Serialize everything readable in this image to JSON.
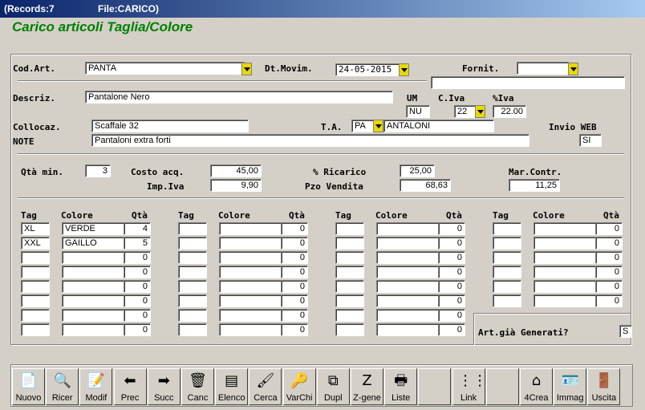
{
  "window": {
    "records": "(Records:7",
    "file": "File:CARICO)"
  },
  "form_title": "Carico articoli Taglia/Colore",
  "labels": {
    "cod_art": "Cod.Art.",
    "dt_movim": "Dt.Movim.",
    "fornit": "Fornit.",
    "descriz": "Descriz.",
    "um": "UM",
    "c_iva": "C.Iva",
    "perc_iva": "%Iva",
    "collocaz": "Collocaz.",
    "ta": "T.A.",
    "invio_web": "Invio WEB",
    "note": "NOTE",
    "qta_min": "Qtà min.",
    "costo_acq": "Costo acq.",
    "ricarico": "% Ricarico",
    "mar_contr": "Mar.Contr.",
    "imp_iva": "Imp.Iva",
    "pzo_vendita": "Pzo Vendita",
    "tag": "Tag",
    "colore": "Colore",
    "qta": "Qtà",
    "gia_generati": "Art.già Generati?"
  },
  "fields": {
    "cod_art": "PANTA",
    "dt_movim": "24-05-2015",
    "fornit": "",
    "fornit_desc": "",
    "descriz": "Pantalone Nero",
    "um": "NU",
    "c_iva": "22",
    "perc_iva": "22.00",
    "collocaz": "Scaffale 32",
    "ta_code": "PA",
    "ta_desc": "ANTALONI",
    "invio_web": "SI",
    "note": "Pantaloni extra forti",
    "qta_min": "3",
    "costo_acq": "45,00",
    "ricarico": "25,00",
    "mar_contr": "11,25",
    "imp_iva": "9,90",
    "pzo_vendita": "68,63",
    "gia_generati": "S"
  },
  "grid": [
    {
      "rows": [
        {
          "tag": "XL",
          "colore": "VERDE",
          "qta": "4"
        },
        {
          "tag": "XXL",
          "colore": "GAILLO",
          "qta": "5"
        },
        {
          "tag": "",
          "colore": "",
          "qta": "0"
        },
        {
          "tag": "",
          "colore": "",
          "qta": "0"
        },
        {
          "tag": "",
          "colore": "",
          "qta": "0"
        },
        {
          "tag": "",
          "colore": "",
          "qta": "0"
        },
        {
          "tag": "",
          "colore": "",
          "qta": "0"
        },
        {
          "tag": "",
          "colore": "",
          "qta": "0"
        }
      ]
    },
    {
      "rows": [
        {
          "tag": "",
          "colore": "",
          "qta": "0"
        },
        {
          "tag": "",
          "colore": "",
          "qta": "0"
        },
        {
          "tag": "",
          "colore": "",
          "qta": "0"
        },
        {
          "tag": "",
          "colore": "",
          "qta": "0"
        },
        {
          "tag": "",
          "colore": "",
          "qta": "0"
        },
        {
          "tag": "",
          "colore": "",
          "qta": "0"
        },
        {
          "tag": "",
          "colore": "",
          "qta": "0"
        },
        {
          "tag": "",
          "colore": "",
          "qta": "0"
        }
      ]
    },
    {
      "rows": [
        {
          "tag": "",
          "colore": "",
          "qta": "0"
        },
        {
          "tag": "",
          "colore": "",
          "qta": "0"
        },
        {
          "tag": "",
          "colore": "",
          "qta": "0"
        },
        {
          "tag": "",
          "colore": "",
          "qta": "0"
        },
        {
          "tag": "",
          "colore": "",
          "qta": "0"
        },
        {
          "tag": "",
          "colore": "",
          "qta": "0"
        },
        {
          "tag": "",
          "colore": "",
          "qta": "0"
        },
        {
          "tag": "",
          "colore": "",
          "qta": "0"
        }
      ]
    },
    {
      "rows": [
        {
          "tag": "",
          "colore": "",
          "qta": "0"
        },
        {
          "tag": "",
          "colore": "",
          "qta": "0"
        },
        {
          "tag": "",
          "colore": "",
          "qta": "0"
        },
        {
          "tag": "",
          "colore": "",
          "qta": "0"
        },
        {
          "tag": "",
          "colore": "",
          "qta": "0"
        },
        {
          "tag": "",
          "colore": "",
          "qta": "0"
        }
      ]
    }
  ],
  "toolbar": [
    {
      "name": "nuovo-button",
      "icon": "new-document-icon",
      "glyph": "📄",
      "label": "Nuovo"
    },
    {
      "name": "ricer-button",
      "icon": "search-icon",
      "glyph": "🔍",
      "label": "Ricer"
    },
    {
      "name": "modif-button",
      "icon": "edit-document-icon",
      "glyph": "📝",
      "label": "Modif"
    },
    {
      "name": "prec-button",
      "icon": "arrow-left-icon",
      "glyph": "⬅",
      "label": "Prec"
    },
    {
      "name": "succ-button",
      "icon": "arrow-right-icon",
      "glyph": "➡",
      "label": "Succ"
    },
    {
      "name": "canc-button",
      "icon": "trash-icon",
      "glyph": "🗑",
      "label": "Canc"
    },
    {
      "name": "elenco-button",
      "icon": "list-icon",
      "glyph": "▤",
      "label": "Elenco"
    },
    {
      "name": "cerca-button",
      "icon": "brush-icon",
      "glyph": "🖌",
      "label": "Cerca"
    },
    {
      "name": "varchi-button",
      "icon": "keys-icon",
      "glyph": "🔑",
      "label": "VarChi"
    },
    {
      "name": "dupl-button",
      "icon": "duplicate-icon",
      "glyph": "⧉",
      "label": "Dupl"
    },
    {
      "name": "z-gene-button",
      "icon": "z-generate-icon",
      "glyph": "Z",
      "label": "Z-gene"
    },
    {
      "name": "liste-button",
      "icon": "printer-icon",
      "glyph": "🖶",
      "label": "Liste"
    },
    {
      "name": "blank-button-1",
      "icon": "",
      "glyph": "",
      "label": ""
    },
    {
      "name": "link-button",
      "icon": "link-icon",
      "glyph": "⋮⋮",
      "label": "Link"
    },
    {
      "name": "blank-button-2",
      "icon": "",
      "glyph": "",
      "label": ""
    },
    {
      "name": "4crea-button",
      "icon": "create-icon",
      "glyph": "⌂",
      "label": "4Crea"
    },
    {
      "name": "immag-button",
      "icon": "image-card-icon",
      "glyph": "🪪",
      "label": "Immag"
    },
    {
      "name": "uscita-button",
      "icon": "exit-door-icon",
      "glyph": "🚪",
      "label": "Uscita"
    }
  ],
  "colors": {
    "title_green": "#008000",
    "dropdown_yellow": "#e8d800",
    "titlebar_blue": "#0a246a"
  }
}
